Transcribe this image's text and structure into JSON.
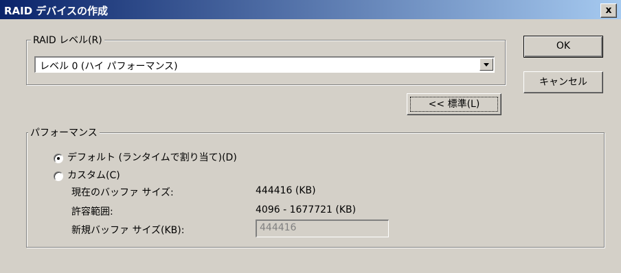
{
  "window": {
    "title": "RAID デバイスの作成",
    "close_label": "x"
  },
  "raid_level": {
    "group_label": "RAID レベル(R)",
    "selected": "レベル 0 (ハイ パフォーマンス)"
  },
  "buttons": {
    "ok": "OK",
    "cancel": "キャンセル",
    "standard": "<< 標準(L)"
  },
  "performance": {
    "group_label": "パフォーマンス",
    "default_option": "デフォルト (ランタイムで割り当て)(D)",
    "default_selected": true,
    "custom_option": "カスタム(C)",
    "current_buffer_label": "現在のバッファ サイズ:",
    "current_buffer_value": "444416 (KB)",
    "allowed_range_label": "許容範囲:",
    "allowed_range_value": "4096 - 1677721 (KB)",
    "new_buffer_label": "新規バッファ サイズ(KB):",
    "new_buffer_value": "444416"
  }
}
